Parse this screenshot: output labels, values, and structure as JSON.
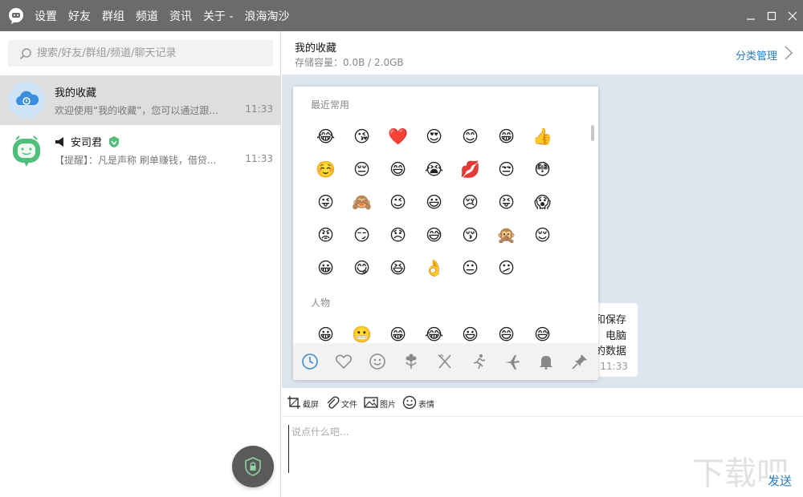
{
  "titlebar": {
    "menu": [
      "设置",
      "好友",
      "群组",
      "频道",
      "资讯",
      "关于 -",
      "浪海淘沙"
    ]
  },
  "search": {
    "placeholder": "搜索/好友/群组/频道/聊天记录"
  },
  "chats": [
    {
      "name": "我的收藏",
      "preview": "欢迎使用“我的收藏”，您可以通过跟...",
      "time": "11:33"
    },
    {
      "name": "安司君",
      "preview": "【提醒】：凡是声称 刷单赚钱，借贷...",
      "time": "11:33"
    }
  ],
  "header": {
    "title": "我的收藏",
    "subtitle": "存储容量：0.0B / 2.0GB",
    "manage": "分类管理"
  },
  "bubble": {
    "lines": [
      "和保存",
      "电脑",
      "的数据"
    ],
    "time": "11:33"
  },
  "emoji_panel": {
    "section_recent": "最近常用",
    "section_people": "人物",
    "recent": [
      "😂",
      "😘",
      "❤️",
      "😍",
      "😊",
      "😁",
      "👍",
      "☺️",
      "😔",
      "😄",
      "😭",
      "💋",
      "😒",
      "😳",
      "😜",
      "🙈",
      "😉",
      "😃",
      "😢",
      "😝",
      "😱",
      "😡",
      "😏",
      "😞",
      "😅",
      "😚",
      "🙊",
      "😌",
      "😀",
      "😋",
      "😆",
      "👌",
      "😐",
      "😕"
    ],
    "people": [
      "😀",
      "😬",
      "😁",
      "😂",
      "😃",
      "😄",
      "😅"
    ],
    "tabs": [
      "recent-clock-icon",
      "heart-icon",
      "smiley-icon",
      "flower-icon",
      "food-icon",
      "running-icon",
      "airplane-icon",
      "bell-icon",
      "pin-icon"
    ]
  },
  "toolbar": {
    "screenshot": "截屏",
    "file": "文件",
    "image": "图片",
    "emoji": "表情"
  },
  "input": {
    "placeholder": "说点什么吧..."
  },
  "send_label": "发送",
  "colors": {
    "titlebar": "#6b6b6b",
    "accent": "#2a7db8",
    "msgarea": "#dde6ee"
  }
}
